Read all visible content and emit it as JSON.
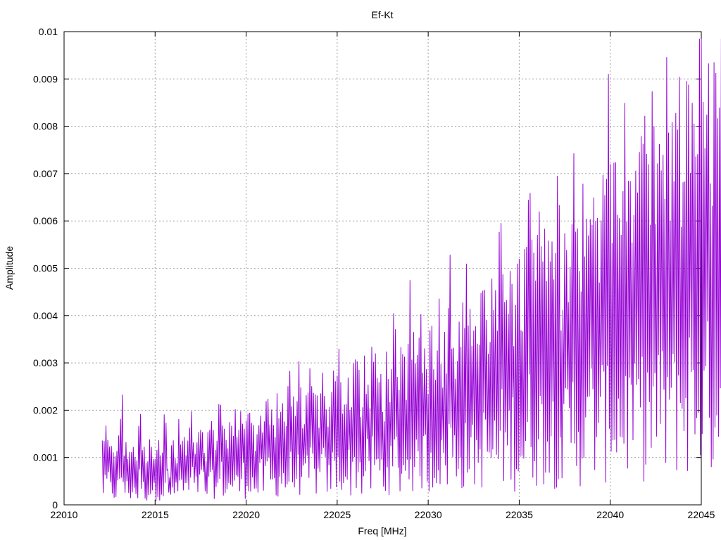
{
  "chart_data": {
    "type": "line",
    "title": "Ef-Kt",
    "xlabel": "Freq [MHz]",
    "ylabel": "Amplitude",
    "xlim": [
      22010,
      22045
    ],
    "ylim": [
      0,
      0.01
    ],
    "x_ticks": [
      "22010",
      "22015",
      "22020",
      "22025",
      "22030",
      "22035",
      "22040",
      "22045"
    ],
    "y_ticks": [
      "0",
      "0.001",
      "0.002",
      "0.003",
      "0.004",
      "0.005",
      "0.006",
      "0.007",
      "0.008",
      "0.009",
      "0.01"
    ],
    "grid": true,
    "legend": "none",
    "series": [
      {
        "color": "#9400d3",
        "x_start": 22012.1,
        "x_step": 0.2,
        "values": [
          0.0009,
          0.0011,
          0.0008,
          0.0007,
          0.0009,
          0.0015,
          0.0008,
          0.0007,
          0.0009,
          0.0006,
          0.0012,
          0.0008,
          0.0006,
          0.0009,
          0.0007,
          0.0009,
          0.0008,
          0.0012,
          0.0005,
          0.0009,
          0.0007,
          0.0011,
          0.0009,
          0.0008,
          0.0013,
          0.0009,
          0.0011,
          0.0012,
          0.0008,
          0.001,
          0.0012,
          0.0009,
          0.0014,
          0.0011,
          0.0009,
          0.0013,
          0.0012,
          0.001,
          0.0014,
          0.0012,
          0.0016,
          0.0011,
          0.0009,
          0.0014,
          0.0012,
          0.0017,
          0.0013,
          0.0011,
          0.0015,
          0.0014,
          0.0012,
          0.0017,
          0.0014,
          0.0016,
          0.0018,
          0.0013,
          0.0015,
          0.0019,
          0.0016,
          0.0014,
          0.0018,
          0.0016,
          0.0013,
          0.0018,
          0.0017,
          0.0021,
          0.0015,
          0.0018,
          0.0016,
          0.0021,
          0.0019,
          0.0014,
          0.002,
          0.0016,
          0.0022,
          0.0019,
          0.0018,
          0.0015,
          0.002,
          0.0018,
          0.0024,
          0.0016,
          0.0021,
          0.0019,
          0.0028,
          0.0022,
          0.002,
          0.0026,
          0.0024,
          0.0019,
          0.0025,
          0.0022,
          0.0027,
          0.0021,
          0.0024,
          0.0033,
          0.0026,
          0.0023,
          0.0028,
          0.0026,
          0.0032,
          0.0025,
          0.0028,
          0.0024,
          0.0031,
          0.0029,
          0.0026,
          0.003,
          0.0027,
          0.0036,
          0.0029,
          0.0033,
          0.0038,
          0.0027,
          0.0031,
          0.0029,
          0.0035,
          0.0042,
          0.0036,
          0.0034,
          0.0039,
          0.0035,
          0.0041,
          0.0038,
          0.0033,
          0.0047,
          0.0031,
          0.0039,
          0.0036,
          0.0045,
          0.0039,
          0.0034,
          0.0042,
          0.0038,
          0.0049,
          0.0041,
          0.0037,
          0.0046,
          0.0042,
          0.0058,
          0.0044,
          0.0047,
          0.0041,
          0.0051,
          0.0045,
          0.0048,
          0.0043,
          0.0053,
          0.0046,
          0.0049,
          0.0044,
          0.0052,
          0.0047,
          0.0051,
          0.0045,
          0.0056,
          0.0049,
          0.0053,
          0.0061,
          0.0049,
          0.0054,
          0.0058,
          0.0051,
          0.0055,
          0.0062,
          0.0052,
          0.0057,
          0.0053,
          0.0059,
          0.0054,
          0.0063,
          0.0058,
          0.0055,
          0.006,
          0.0056,
          0.0064,
          0.0058,
          0.0061,
          0.0057,
          0.0063,
          0.0059,
          0.0066,
          0.006,
          0.0062,
          0.0058,
          0.0064,
          0.0067,
          0.006,
          0.0062,
          0.0059,
          0.0061,
          0.0066,
          0.0058,
          0.0063,
          0.0057,
          0.0062,
          0.0059,
          0.0055,
          0.0057,
          0.0053,
          0.0055,
          0.0051,
          0.0052,
          0.0049,
          0.0047,
          0.0045,
          0.0052,
          0.0044,
          0.0041,
          0.0039,
          0.0043,
          0.0038,
          0.0035,
          0.0041,
          0.0036,
          0.0032,
          0.0038,
          0.0034,
          0.0029,
          0.0033
        ]
      }
    ]
  }
}
